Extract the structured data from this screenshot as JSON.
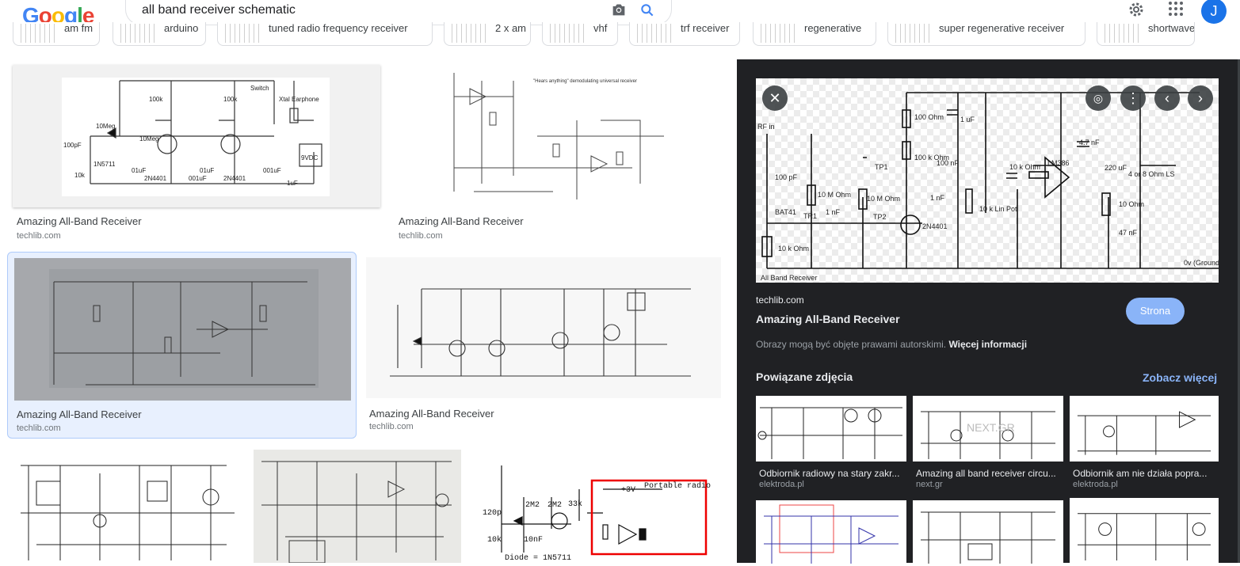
{
  "search": {
    "query": "all band receiver schematic"
  },
  "header": {
    "avatar_letter": "J"
  },
  "chips": [
    {
      "label": "am fm"
    },
    {
      "label": "arduino"
    },
    {
      "label": "tuned radio frequency receiver"
    },
    {
      "label": "2 x am"
    },
    {
      "label": "vhf"
    },
    {
      "label": "trf receiver"
    },
    {
      "label": "regenerative"
    },
    {
      "label": "super regenerative receiver"
    },
    {
      "label": "shortwave"
    }
  ],
  "results": [
    {
      "title": "Amazing All-Band Receiver",
      "source": "techlib.com"
    },
    {
      "title": "Amazing All-Band Receiver",
      "source": "techlib.com"
    },
    {
      "title": "Amazing All-Band Receiver",
      "source": "techlib.com"
    },
    {
      "title": "Amazing All-Band Receiver",
      "source": "techlib.com"
    }
  ],
  "schematic_labels": {
    "r1": "10Meg",
    "r2": "100k",
    "r3": "100k",
    "sw": "Switch",
    "earphone": "Xtal Earphone",
    "c1": "100pF",
    "d1": "1N5711",
    "r4": "10k",
    "c2": "01uF",
    "q1": "2N4401",
    "c3": "001uF",
    "c4": "01uF",
    "q2": "2N4401",
    "c5": "001uF",
    "batt": "9VDC",
    "c6": "1uF",
    "r5": "10Meg"
  },
  "bottom_thumb": {
    "label_v": "+3V",
    "label_radio": "Portable radio",
    "diode": "Diode = 1N5711",
    "c": "120p",
    "r": "10k",
    "r2": "2M2",
    "r3": "2M2",
    "r4": "33k",
    "c2": "10nF"
  },
  "panel": {
    "source": "techlib.com",
    "title": "Amazing All-Band Receiver",
    "visit_label": "Strona",
    "copyright": "Obrazy mogą być objęte prawami autorskimi.",
    "copyright_link": "Więcej informacji",
    "related_heading": "Powiązane zdjęcia",
    "see_more": "Zobacz więcej",
    "schem": {
      "rf": "RF in",
      "c1": "100 pF",
      "r1": "10 M Ohm",
      "d1": "BAT41",
      "tr1": "TR1",
      "c2": "1 nF",
      "r2": "10 k Ohm",
      "r3": "100 Ohm",
      "r4": "100 k Ohm",
      "c3": "100 nF",
      "r5": "10 M Ohm",
      "tp1": "TP1",
      "tp2": "TP2",
      "q": "2N4401",
      "c4": "1 nF",
      "pot": "10 k Lin Pot",
      "c5": "1 uF",
      "r6": "10 k Ohm",
      "ic": "LM386",
      "c6": "4.7 nF",
      "c7": "220 uF",
      "ls": "4 or 8 Ohm LS",
      "r7": "10 Ohm",
      "c8": "47 nF",
      "gnd": "0v (Ground)",
      "caption": "All Band Receiver"
    },
    "related": [
      {
        "title": "Odbiornik radiowy na stary zakr...",
        "source": "elektroda.pl"
      },
      {
        "title": "Amazing all band receiver circu...",
        "source": "next.gr"
      },
      {
        "title": "Odbiornik am nie działa popra...",
        "source": "elektroda.pl"
      },
      {
        "title": "",
        "source": ""
      },
      {
        "title": "",
        "source": ""
      },
      {
        "title": "",
        "source": ""
      }
    ]
  }
}
